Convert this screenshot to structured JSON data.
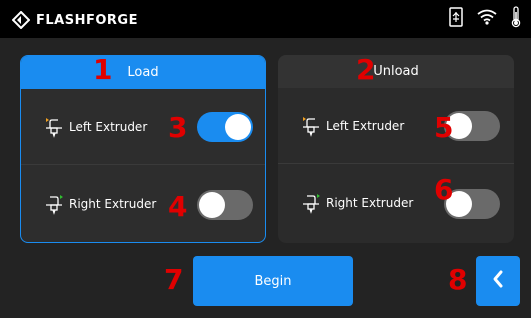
{
  "brand": {
    "name": "FLASHFORGE"
  },
  "status_icons": [
    "usb-icon",
    "wifi-icon",
    "thermometer-icon"
  ],
  "load_panel": {
    "title": "Load",
    "left_extruder": {
      "label": "Left Extruder",
      "enabled": true
    },
    "right_extruder": {
      "label": "Right Extruder",
      "enabled": false
    }
  },
  "unload_panel": {
    "title": "Unload",
    "left_extruder": {
      "label": "Left Extruder",
      "enabled": false
    },
    "right_extruder": {
      "label": "Right Extruder",
      "enabled": false
    }
  },
  "begin_label": "Begin",
  "markers": [
    "1",
    "2",
    "3",
    "4",
    "5",
    "6",
    "7",
    "8"
  ],
  "colors": {
    "accent": "#1a8cf0",
    "marker": "#e00000",
    "background": "#232323"
  }
}
